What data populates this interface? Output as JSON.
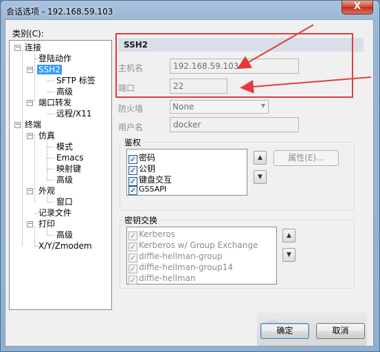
{
  "window": {
    "title": "会话选项 - 192.168.59.103",
    "close_label": "X"
  },
  "tree": {
    "label": "类别(C):",
    "items": [
      {
        "text": "连接",
        "expander": "−"
      },
      {
        "text": "登陆动作"
      },
      {
        "text": "SSH2",
        "expander": "−",
        "selected": true
      },
      {
        "text": "SFTP 标签"
      },
      {
        "text": "高级"
      },
      {
        "text": "端口转发",
        "expander": "−"
      },
      {
        "text": "远程/X11"
      },
      {
        "text": "终端",
        "expander": "−"
      },
      {
        "text": "仿真",
        "expander": "−"
      },
      {
        "text": "模式"
      },
      {
        "text": "Emacs"
      },
      {
        "text": "映射键"
      },
      {
        "text": "高级"
      },
      {
        "text": "外观",
        "expander": "−"
      },
      {
        "text": "窗口"
      },
      {
        "text": "记录文件"
      },
      {
        "text": "打印",
        "expander": "−"
      },
      {
        "text": "高级"
      },
      {
        "text": "X/Y/Zmodem"
      }
    ]
  },
  "ssh2": {
    "header": "SSH2",
    "hostname_label": "主机名",
    "hostname_value": "192.168.59.103",
    "port_label": "端口",
    "port_value": "22",
    "firewall_label": "防火墙",
    "firewall_value": "None",
    "username_label": "用户名",
    "username_value": "docker"
  },
  "auth": {
    "title": "鉴权",
    "items": [
      "密码",
      "公钥",
      "键盘交互",
      "GSSAPI"
    ],
    "properties_label": "属性(E)..."
  },
  "kex": {
    "title": "密钥交换",
    "items": [
      "Kerberos",
      "Kerberos w/ Group Exchange",
      "diffie-hellman-group",
      "diffie-hellman-group14",
      "diffie-hellman"
    ]
  },
  "footer": {
    "ok_label": "确定",
    "cancel_label": "取消"
  },
  "icons": {
    "check": "✓",
    "up": "▲",
    "down": "▼",
    "combo": "▼"
  },
  "colors": {
    "annotation": "#e53a3a",
    "selection": "#3399ff"
  }
}
